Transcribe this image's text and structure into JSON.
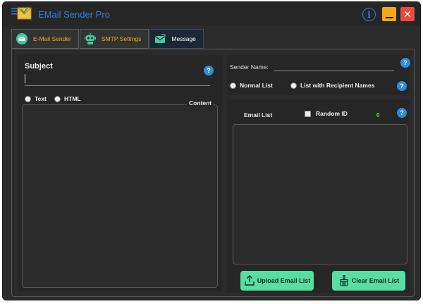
{
  "app": {
    "title": "EMail Sender Pro",
    "info_glyph": "i",
    "close_glyph": "✕",
    "accent": "#2f7fe0"
  },
  "tabs": [
    {
      "label": "E-Mail Sender",
      "icon": "email-icon",
      "active": false
    },
    {
      "label": "SMTP Settings",
      "icon": "robot-icon",
      "active": false
    },
    {
      "label": "Message",
      "icon": "mail-send-icon",
      "active": true
    }
  ],
  "message": {
    "subject_label": "Subject",
    "subject_value": "",
    "format_options": [
      "Text",
      "HTML"
    ],
    "content_label": "Content",
    "help_glyph": "?"
  },
  "sender": {
    "name_label": "Sender Name:",
    "name_value": "",
    "list_options": [
      "Normal List",
      "List with Recipient Names"
    ]
  },
  "email_list": {
    "label": "Email List",
    "random_id_label": "Random ID",
    "random_id_checked": false,
    "count": "0",
    "upload_button": "Upload Email List",
    "clear_button": "Clear Email List",
    "button_color": "#57dfa3"
  }
}
